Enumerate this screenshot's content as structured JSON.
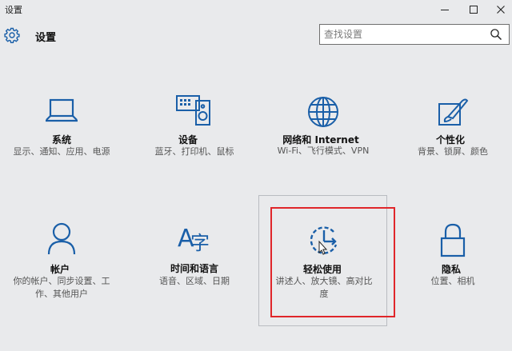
{
  "window": {
    "title": "设置"
  },
  "header": {
    "title": "设置"
  },
  "search": {
    "placeholder": "查找设置"
  },
  "tiles": [
    {
      "title": "系统",
      "desc": "显示、通知、应用、电源",
      "icon": "laptop-icon"
    },
    {
      "title": "设备",
      "desc": "蓝牙、打印机、鼠标",
      "icon": "devices-icon"
    },
    {
      "title": "网络和 Internet",
      "desc": "Wi-Fi、飞行模式、VPN",
      "icon": "globe-icon"
    },
    {
      "title": "个性化",
      "desc": "背景、锁屏、颜色",
      "icon": "paint-icon"
    },
    {
      "title": "帐户",
      "desc": "你的帐户、同步设置、工作、其他用户",
      "icon": "person-icon"
    },
    {
      "title": "时间和语言",
      "desc": "语音、区域、日期",
      "icon": "language-icon"
    },
    {
      "title": "轻松使用",
      "desc": "讲述人、放大镜、高对比度",
      "icon": "ease-of-access-icon"
    },
    {
      "title": "隐私",
      "desc": "位置、相机",
      "icon": "lock-icon"
    }
  ],
  "colors": {
    "accent": "#1a5fa8",
    "highlight": "#e0262a",
    "background": "#e9eaec"
  }
}
